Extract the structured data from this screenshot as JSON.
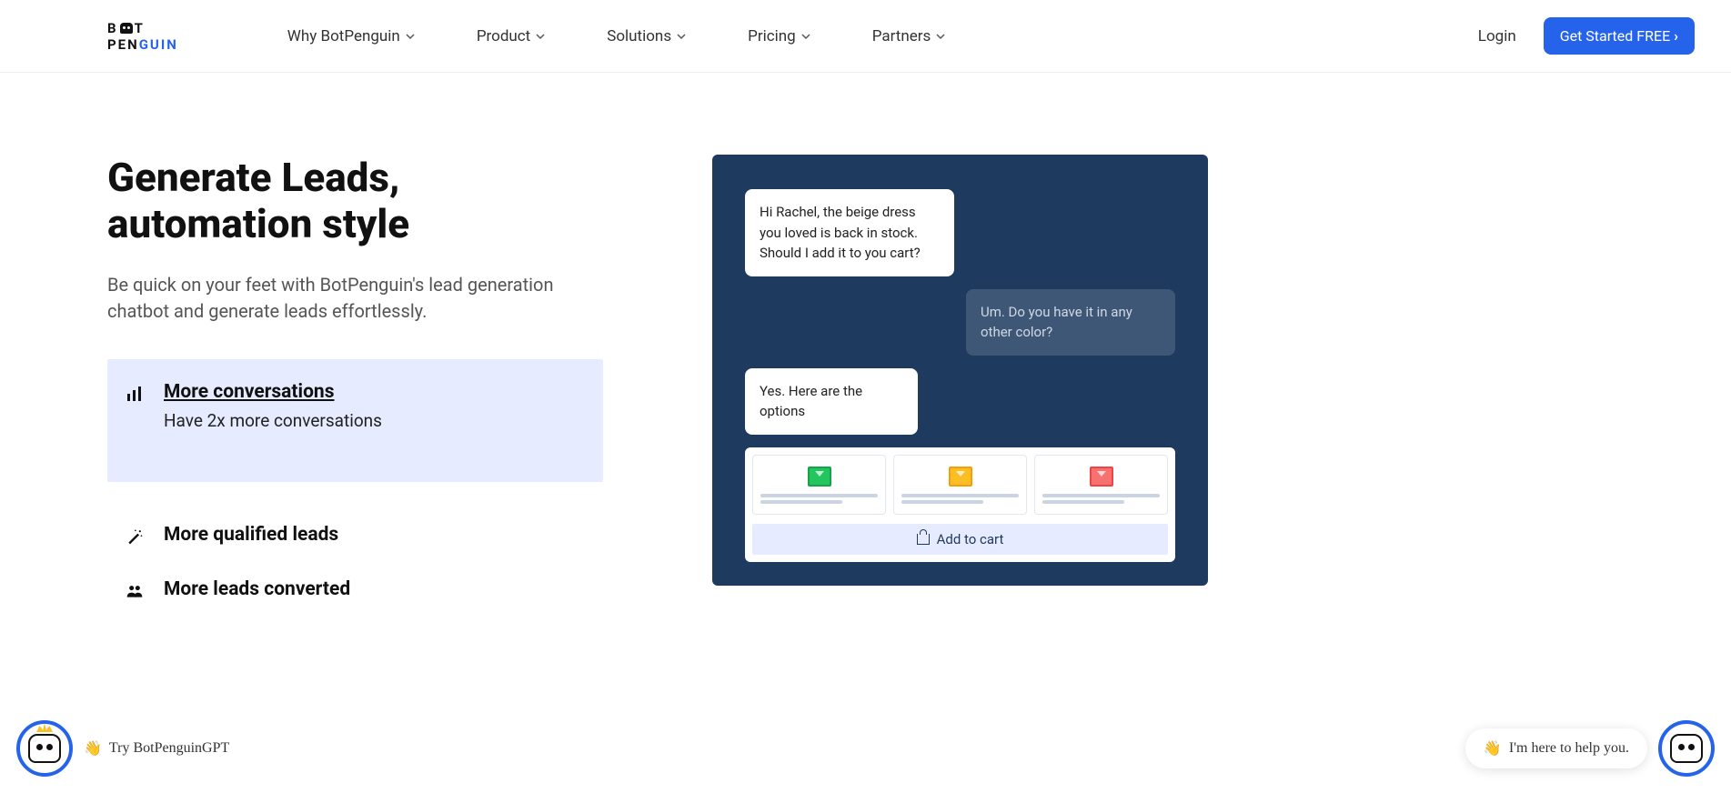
{
  "header": {
    "logo_top": "B T",
    "logo_bottom_pen": "PEN",
    "logo_bottom_guin": "GUIN",
    "nav": [
      {
        "label": "Why BotPenguin"
      },
      {
        "label": "Product"
      },
      {
        "label": "Solutions"
      },
      {
        "label": "Pricing"
      },
      {
        "label": "Partners"
      }
    ],
    "login": "Login",
    "cta": "Get Started FREE"
  },
  "hero": {
    "title": "Generate Leads, automation style",
    "subtitle": "Be quick on your feet with BotPenguin's lead generation chatbot and generate leads effortlessly."
  },
  "features": [
    {
      "title": "More conversations",
      "desc": "Have 2x more conversations",
      "active": true
    },
    {
      "title": "More qualified leads"
    },
    {
      "title": "More leads converted"
    }
  ],
  "chat": {
    "bot1": "Hi Rachel, the beige dress you loved is back in stock. Should I add it to you cart?",
    "user1": "Um. Do you have it in any other color?",
    "bot2": "Yes. Here are the options",
    "add_cart": "Add to cart",
    "swatches": [
      "green",
      "orange",
      "red"
    ]
  },
  "float": {
    "left_text": "Try BotPenguinGPT",
    "right_text": "I'm here to help you.",
    "wave": "👋"
  }
}
